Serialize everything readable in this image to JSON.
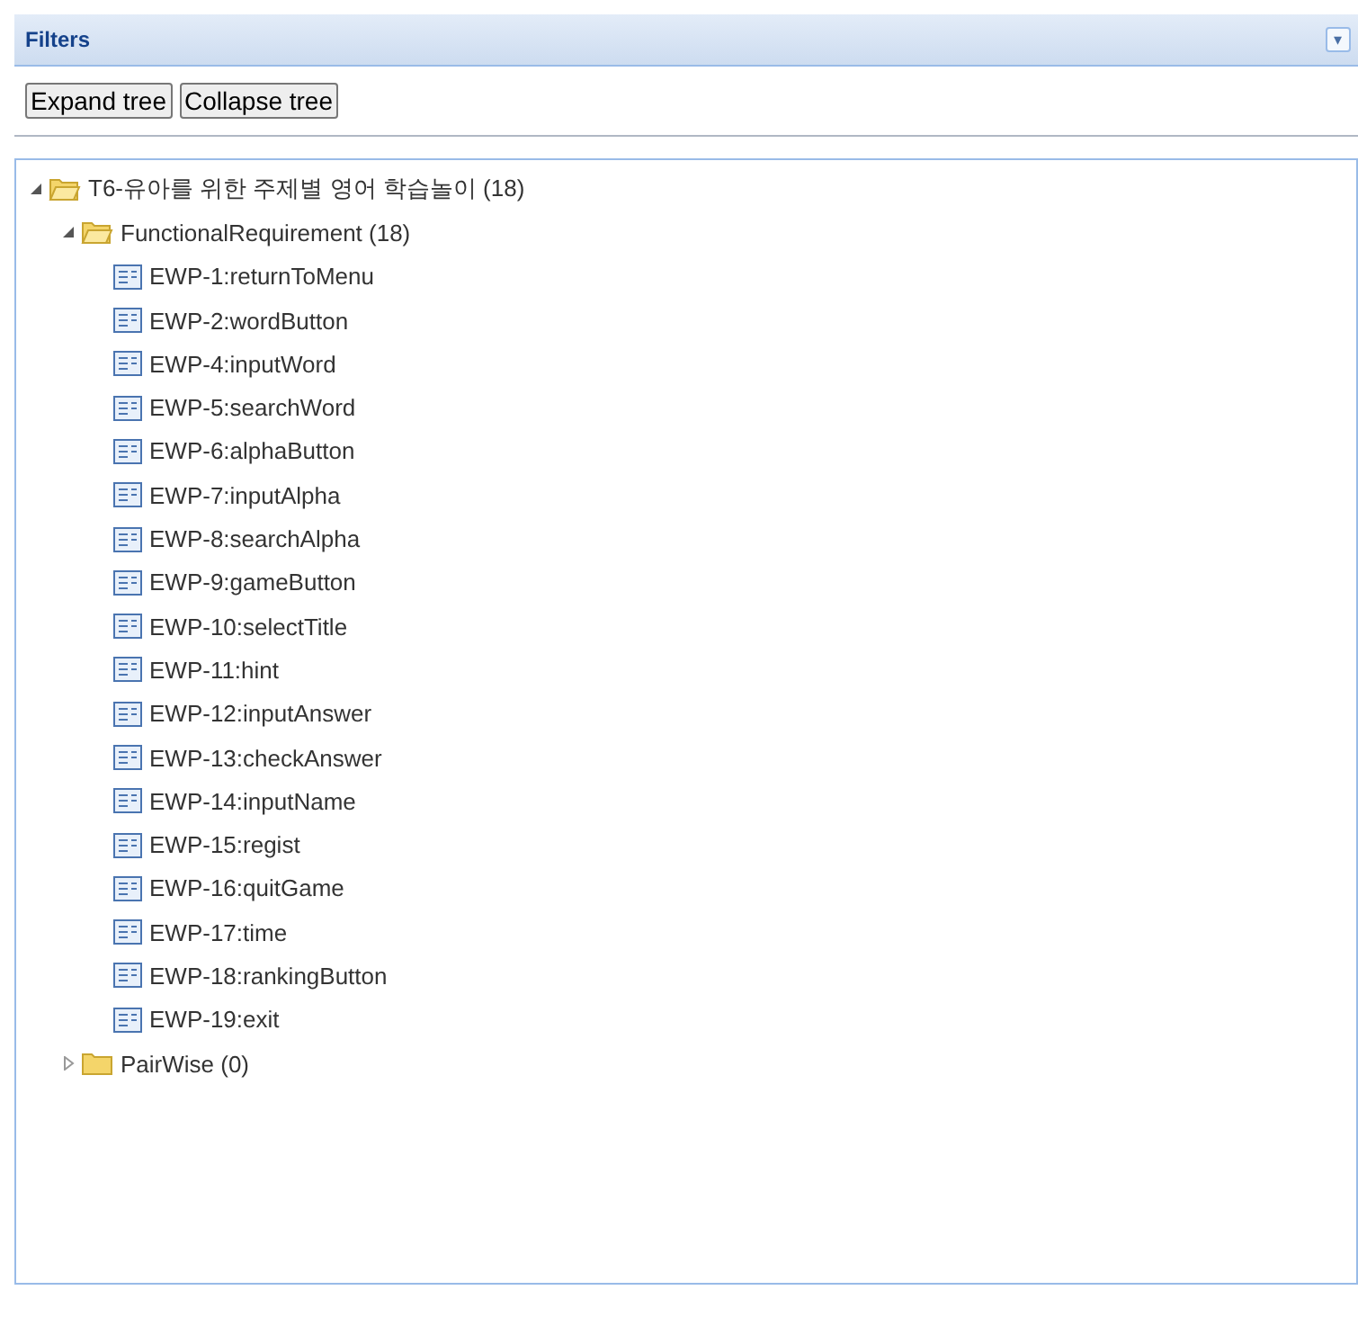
{
  "panel": {
    "title": "Filters",
    "collapse_button": "▾"
  },
  "buttons": [
    "Expand tree",
    "Collapse tree"
  ],
  "tree": [
    {
      "kind": "folder",
      "label": "T6-유아를 위한 주제별 영어 학습놀이 (18)",
      "expanded": true,
      "children": [
        {
          "kind": "folder",
          "label": "FunctionalRequirement (18)",
          "expanded": true,
          "children": [
            {
              "kind": "leaf",
              "label": "EWP-1:returnToMenu"
            },
            {
              "kind": "leaf",
              "label": "EWP-2:wordButton"
            },
            {
              "kind": "leaf",
              "label": "EWP-4:inputWord"
            },
            {
              "kind": "leaf",
              "label": "EWP-5:searchWord"
            },
            {
              "kind": "leaf",
              "label": "EWP-6:alphaButton"
            },
            {
              "kind": "leaf",
              "label": "EWP-7:inputAlpha"
            },
            {
              "kind": "leaf",
              "label": "EWP-8:searchAlpha"
            },
            {
              "kind": "leaf",
              "label": "EWP-9:gameButton"
            },
            {
              "kind": "leaf",
              "label": "EWP-10:selectTitle"
            },
            {
              "kind": "leaf",
              "label": "EWP-11:hint"
            },
            {
              "kind": "leaf",
              "label": "EWP-12:inputAnswer"
            },
            {
              "kind": "leaf",
              "label": "EWP-13:checkAnswer"
            },
            {
              "kind": "leaf",
              "label": "EWP-14:inputName"
            },
            {
              "kind": "leaf",
              "label": "EWP-15:regist"
            },
            {
              "kind": "leaf",
              "label": "EWP-16:quitGame"
            },
            {
              "kind": "leaf",
              "label": "EWP-17:time"
            },
            {
              "kind": "leaf",
              "label": "EWP-18:rankingButton"
            },
            {
              "kind": "leaf",
              "label": "EWP-19:exit"
            }
          ]
        },
        {
          "kind": "folder",
          "label": "PairWise (0)",
          "expanded": false
        }
      ]
    }
  ]
}
